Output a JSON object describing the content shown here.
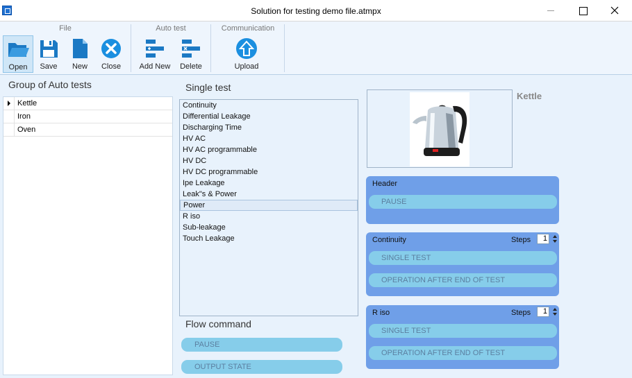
{
  "window": {
    "title": "Solution for testing demo file.atmpx"
  },
  "ribbon": {
    "groups": {
      "file": "File",
      "auto_test": "Auto test",
      "communication": "Communication"
    },
    "buttons": {
      "open": "Open",
      "save": "Save",
      "new": "New",
      "close": "Close",
      "add_new": "Add New",
      "delete": "Delete",
      "upload": "Upload"
    }
  },
  "group_panel": {
    "title": "Group of Auto tests",
    "items": [
      "Kettle",
      "Iron",
      "Oven"
    ]
  },
  "single_test": {
    "title": "Single test",
    "items": [
      "Continuity",
      "Differential Leakage",
      "Discharging Time",
      "HV AC",
      "HV AC programmable",
      "HV DC",
      "HV DC programmable",
      "Ipe Leakage",
      "Leak\"s & Power",
      "Power",
      "R iso",
      "Sub-leakage",
      "Touch Leakage"
    ],
    "selected": "Power"
  },
  "flow_command": {
    "title": "Flow command",
    "items": [
      "PAUSE",
      "OUTPUT STATE"
    ]
  },
  "product": {
    "name": "Kettle"
  },
  "sequence": {
    "header": {
      "title": "Header",
      "items": [
        "PAUSE"
      ]
    },
    "continuity": {
      "title": "Continuity",
      "steps_label": "Steps",
      "steps": "1",
      "items": [
        "SINGLE TEST",
        "OPERATION AFTER END OF TEST"
      ]
    },
    "riso": {
      "title": "R iso",
      "steps_label": "Steps",
      "steps": "1",
      "items": [
        "SINGLE TEST",
        "OPERATION AFTER END OF TEST"
      ]
    }
  }
}
